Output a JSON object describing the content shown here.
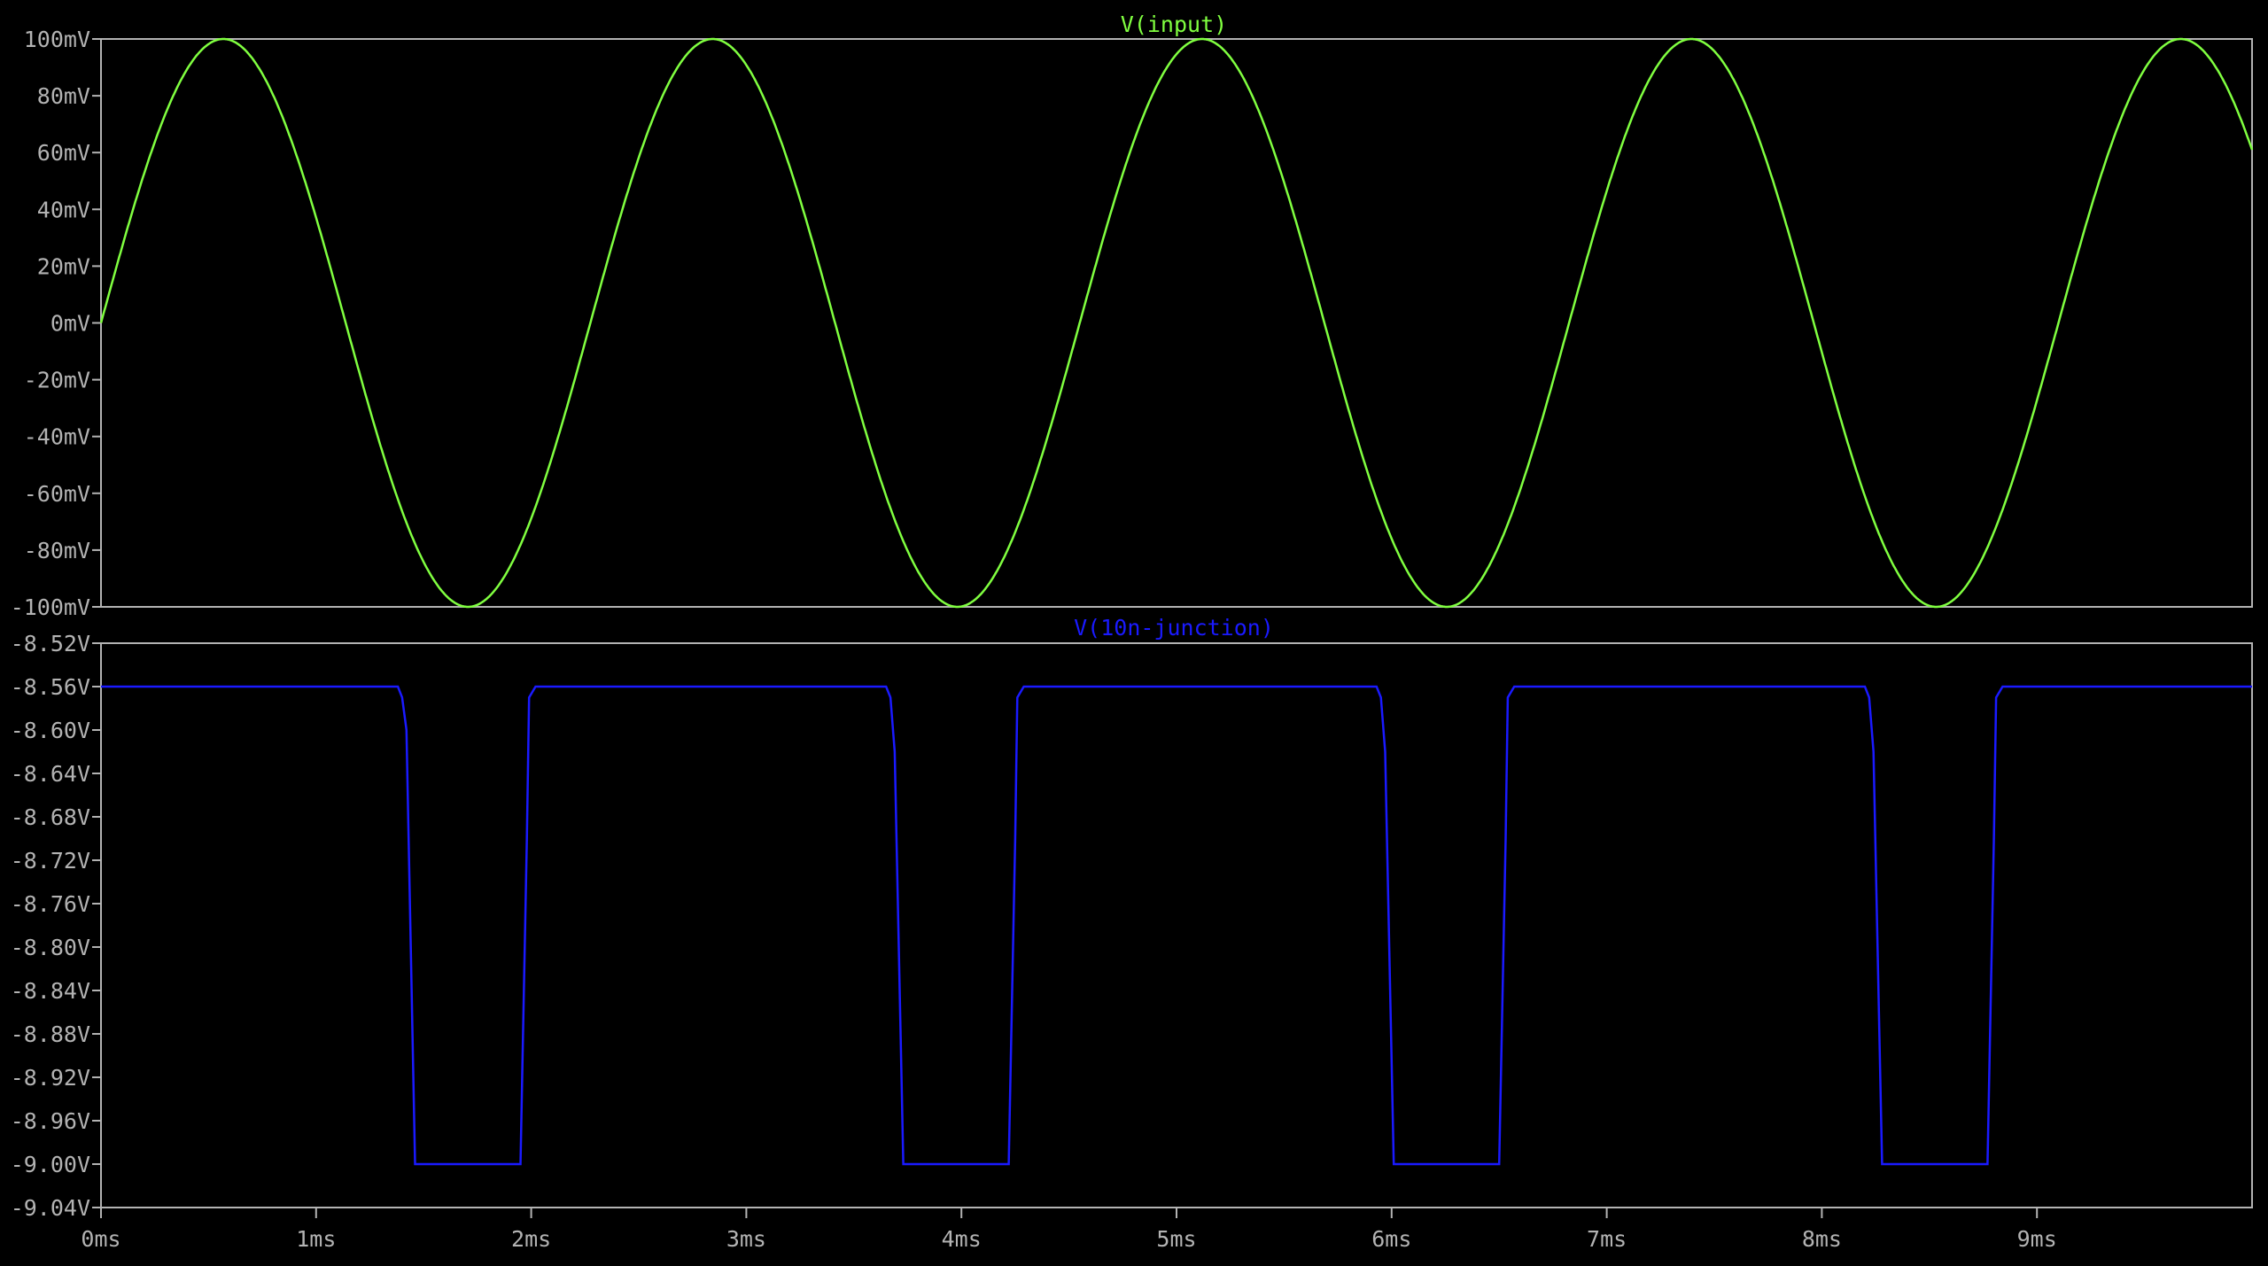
{
  "colors": {
    "background": "#000000",
    "axis": "#b3b3b3",
    "trace_input": "#80ff40",
    "trace_junction": "#1a1aff"
  },
  "chart_data": [
    {
      "type": "line",
      "title": "V(input)",
      "xlabel": "",
      "ylabel": "",
      "grid": false,
      "xlim": [
        0,
        10
      ],
      "ylim": [
        -100,
        100
      ],
      "y_ticks": [
        "100mV",
        "80mV",
        "60mV",
        "40mV",
        "20mV",
        "0mV",
        "-20mV",
        "-40mV",
        "-60mV",
        "-80mV",
        "-100mV"
      ],
      "y_tick_values": [
        100,
        80,
        60,
        40,
        20,
        0,
        -20,
        -40,
        -60,
        -80,
        -100
      ],
      "series": [
        {
          "name": "V(input)",
          "color": "#80ff40",
          "x": [
            0,
            0.57,
            1.71,
            2.85,
            3.98,
            5.12,
            6.26,
            7.4,
            8.53,
            9.67,
            10.0
          ],
          "y": [
            0,
            100,
            -100,
            100,
            -100,
            100,
            -100,
            100,
            -100,
            100,
            60
          ]
        }
      ]
    },
    {
      "type": "line",
      "title": "V(10n-junction)",
      "xlabel": "",
      "ylabel": "",
      "grid": false,
      "xlim": [
        0,
        10
      ],
      "ylim": [
        -9.04,
        -8.52
      ],
      "x_ticks": [
        "0ms",
        "1ms",
        "2ms",
        "3ms",
        "4ms",
        "5ms",
        "6ms",
        "7ms",
        "8ms",
        "9ms"
      ],
      "x_tick_values": [
        0,
        1,
        2,
        3,
        4,
        5,
        6,
        7,
        8,
        9
      ],
      "y_ticks": [
        "-8.52V",
        "-8.56V",
        "-8.60V",
        "-8.64V",
        "-8.68V",
        "-8.72V",
        "-8.76V",
        "-8.80V",
        "-8.84V",
        "-8.88V",
        "-8.92V",
        "-8.96V",
        "-9.00V",
        "-9.04V"
      ],
      "y_tick_values": [
        -8.52,
        -8.56,
        -8.6,
        -8.64,
        -8.68,
        -8.72,
        -8.76,
        -8.8,
        -8.84,
        -8.88,
        -8.92,
        -8.96,
        -9.0,
        -9.04
      ],
      "series": [
        {
          "name": "V(10n-junction)",
          "color": "#1a1aff",
          "x": [
            0,
            1.38,
            1.4,
            1.42,
            1.46,
            1.47,
            1.95,
            1.98,
            1.99,
            2.02,
            3.65,
            3.67,
            3.69,
            3.73,
            3.74,
            4.22,
            4.25,
            4.26,
            4.29,
            5.93,
            5.95,
            5.97,
            6.01,
            6.02,
            6.5,
            6.53,
            6.54,
            6.57,
            8.2,
            8.22,
            8.24,
            8.28,
            8.29,
            8.77,
            8.8,
            8.81,
            8.84,
            10.0
          ],
          "y": [
            -8.56,
            -8.56,
            -8.57,
            -8.6,
            -9.0,
            -9.0,
            -9.0,
            -8.7,
            -8.57,
            -8.56,
            -8.56,
            -8.57,
            -8.62,
            -9.0,
            -9.0,
            -9.0,
            -8.7,
            -8.57,
            -8.56,
            -8.56,
            -8.57,
            -8.62,
            -9.0,
            -9.0,
            -9.0,
            -8.7,
            -8.57,
            -8.56,
            -8.56,
            -8.57,
            -8.62,
            -9.0,
            -9.0,
            -9.0,
            -8.7,
            -8.57,
            -8.56,
            -8.56
          ]
        }
      ]
    }
  ]
}
